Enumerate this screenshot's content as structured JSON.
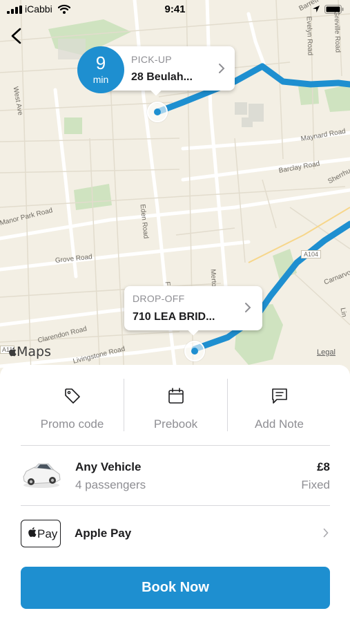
{
  "status_bar": {
    "carrier": "iCabbi",
    "time": "9:41"
  },
  "map": {
    "road_labels": [
      "West Ave",
      "Evelyn Road",
      "Greville Road",
      "Barrett",
      "Maynard Road",
      "Barclay Road",
      "Sherrhu",
      "Manor Park Road",
      "Eden Road",
      "Grove Road",
      "Merto",
      "Fr",
      "A104",
      "Carnarvo",
      "Lin",
      "Clarendon Road",
      "Livingstone Road",
      "A11"
    ],
    "eta": {
      "value": "9",
      "unit": "min"
    },
    "pickup": {
      "label": "PICK-UP",
      "address": "28 Beulah..."
    },
    "dropoff": {
      "label": "DROP-OFF",
      "address": "710 LEA BRID..."
    },
    "attribution": "Maps",
    "legal": "Legal",
    "route_color": "#1e8fd0"
  },
  "actions": [
    {
      "label": "Promo code",
      "icon": "tag-icon"
    },
    {
      "label": "Prebook",
      "icon": "calendar-icon"
    },
    {
      "label": "Add Note",
      "icon": "note-icon"
    }
  ],
  "vehicle": {
    "name": "Any Vehicle",
    "capacity": "4 passengers",
    "price": "£8",
    "price_type": "Fixed"
  },
  "payment": {
    "badge": "Pay",
    "method": "Apple Pay"
  },
  "book_button": "Book Now",
  "accent_color": "#1e8fd0"
}
